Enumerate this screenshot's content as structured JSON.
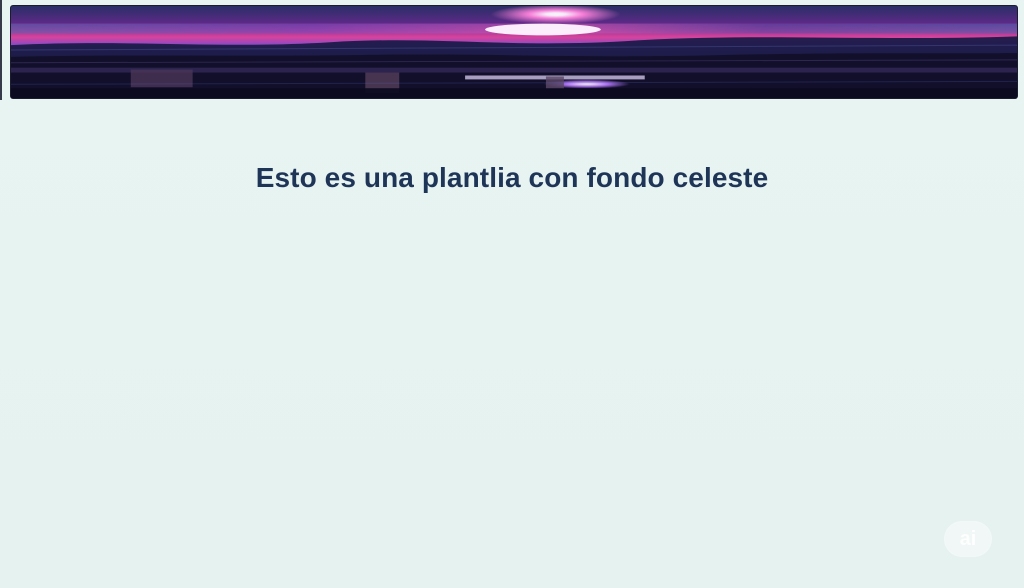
{
  "content": {
    "headline": "Esto es una plantlia con fondo celeste"
  },
  "banner": {
    "image": "purple-night-horizon-banner"
  },
  "watermark": {
    "label": "ai"
  },
  "colors": {
    "background": "#e6f3f1",
    "headline": "#1f3558",
    "banner_dark": "#171634",
    "banner_magenta": "#e84bb6",
    "banner_glow": "#fff4ff"
  }
}
